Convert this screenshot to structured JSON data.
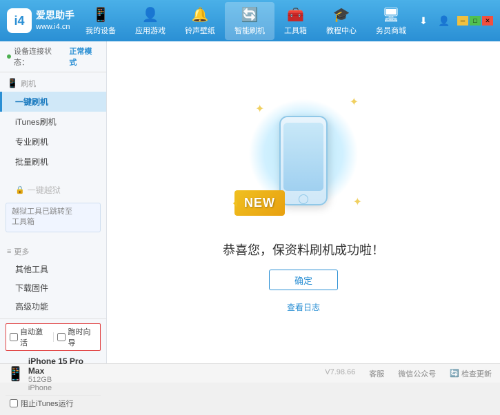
{
  "app": {
    "logo_text_main": "爱思助手",
    "logo_text_sub": "www.i4.cn",
    "logo_char": "i4"
  },
  "nav": {
    "items": [
      {
        "id": "my-device",
        "icon": "📱",
        "label": "我的设备"
      },
      {
        "id": "apps-games",
        "icon": "👤",
        "label": "应用游戏"
      },
      {
        "id": "ringtones",
        "icon": "🔔",
        "label": "铃声壁纸"
      },
      {
        "id": "smart-flash",
        "icon": "🔄",
        "label": "智能刷机",
        "active": true
      },
      {
        "id": "toolbox",
        "icon": "🧰",
        "label": "工具箱"
      },
      {
        "id": "tutorial",
        "icon": "🎓",
        "label": "教程中心"
      },
      {
        "id": "service",
        "icon": "🖥",
        "label": "务员商城"
      }
    ]
  },
  "header_right": {
    "download_icon": "⬇",
    "user_icon": "👤"
  },
  "sidebar": {
    "status_label": "设备连接状态：",
    "status_value": "正常模式",
    "section_flash": {
      "icon": "📱",
      "label": "刷机",
      "items": [
        {
          "id": "one-key-flash",
          "label": "一键刷机",
          "active": true
        },
        {
          "id": "itunes-flash",
          "label": "iTunes刷机"
        },
        {
          "id": "pro-flash",
          "label": "专业刷机"
        },
        {
          "id": "batch-flash",
          "label": "批量刷机"
        }
      ]
    },
    "section_one_click": {
      "label": "一键越狱",
      "disabled": true,
      "notice": "越狱工具已跳转至\n工具箱"
    },
    "section_more": {
      "icon": "≡",
      "label": "更多",
      "items": [
        {
          "id": "other-tools",
          "label": "其他工具"
        },
        {
          "id": "download-firmware",
          "label": "下载固件"
        },
        {
          "id": "advanced",
          "label": "高级功能"
        }
      ]
    },
    "auto_activate": "自动激活",
    "time_guide": "跑时向导",
    "device_name": "iPhone 15 Pro Max",
    "device_storage": "512GB",
    "device_type": "iPhone",
    "block_itunes": "阻止iTunes运行"
  },
  "content": {
    "new_badge_text": "NEW",
    "success_title": "恭喜您，保资料刷机成功啦！",
    "confirm_button": "确定",
    "log_link": "查看日志"
  },
  "footer": {
    "version": "V7.98.66",
    "links": [
      "客服",
      "微信公众号",
      "检查更新"
    ]
  }
}
